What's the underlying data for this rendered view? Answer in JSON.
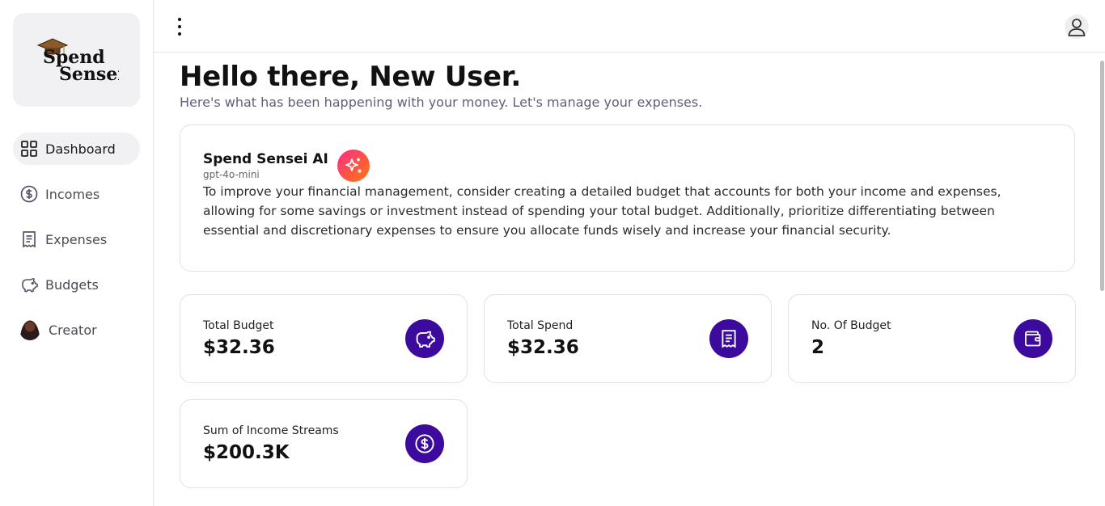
{
  "brand": {
    "line1": "Spend",
    "line2": "Sensei"
  },
  "sidebar": {
    "items": [
      {
        "label": "Dashboard",
        "icon": "dashboard-grid-icon",
        "active": true
      },
      {
        "label": "Incomes",
        "icon": "dollar-circle-icon",
        "active": false
      },
      {
        "label": "Expenses",
        "icon": "receipt-icon",
        "active": false
      },
      {
        "label": "Budgets",
        "icon": "piggy-bank-icon",
        "active": false
      },
      {
        "label": "Creator",
        "icon": "creator-avatar",
        "active": false
      }
    ]
  },
  "header": {
    "menu_icon": "kebab-menu-icon",
    "user_icon": "user-icon"
  },
  "main": {
    "greeting": "Hello there, New User.",
    "subtext": "Here's what has been happening with your money. Let's manage your expenses."
  },
  "ai": {
    "title": "Spend Sensei AI",
    "model": "gpt-4o-mini",
    "advice": "To improve your financial management, consider creating a detailed budget that accounts for both your income and expenses, allowing for some savings or investment instead of spending your total budget. Additionally, prioritize differentiating between essential and discretionary expenses to ensure you allocate funds wisely and increase your financial security."
  },
  "stats": [
    {
      "label": "Total Budget",
      "value": "$32.36",
      "icon": "piggy-bank-icon"
    },
    {
      "label": "Total Spend",
      "value": "$32.36",
      "icon": "receipt-icon"
    },
    {
      "label": "No. Of Budget",
      "value": "2",
      "icon": "wallet-icon"
    },
    {
      "label": "Sum of Income Streams",
      "value": "$200.3K",
      "icon": "dollar-circle-icon"
    }
  ],
  "colors": {
    "accent": "#3c0a9c",
    "ai_gradient_start": "#ff2a8e",
    "ai_gradient_end": "#ff7d1a",
    "active_bg": "#f1f1f3"
  }
}
